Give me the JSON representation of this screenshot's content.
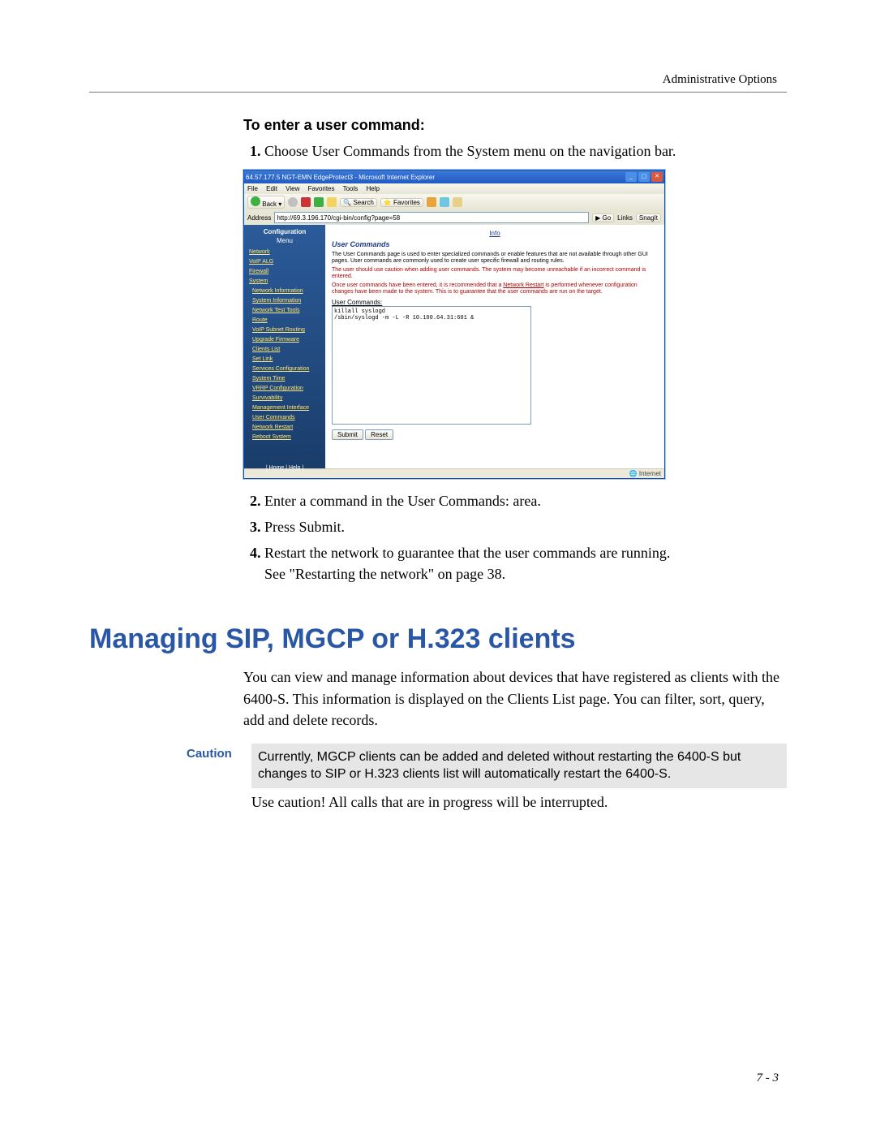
{
  "header": {
    "title": "Administrative Options"
  },
  "procedure": {
    "title": "To enter a user command:",
    "step1": "Choose User Commands from the System menu on the navigation bar.",
    "step2": "Enter a command in the User Commands: area.",
    "step3": "Press Submit.",
    "step4a": "Restart the network to guarantee that the user commands are running.",
    "step4b": "See \"Restarting the network\" on page 38."
  },
  "ie": {
    "title": "64.57.177.5 NGT-EMN EdgeProtect3 - Microsoft Internet Explorer",
    "menu": {
      "file": "File",
      "edit": "Edit",
      "view": "View",
      "fav": "Favorites",
      "tools": "Tools",
      "help": "Help"
    },
    "back": "Back",
    "search": "Search",
    "favbtn": "Favorites",
    "addr_label": "Address",
    "addr_value": "http://69.3.196.170/cgi-bin/config?page=58",
    "go": "Go",
    "links": "Links",
    "snag": "SnagIt",
    "status_left": "",
    "status_right": "Internet"
  },
  "sidebar": {
    "cfg_title": "Configuration",
    "cfg_sub": "Menu",
    "items": [
      "Network",
      "VoIP ALG",
      "Firewall",
      "System"
    ],
    "sys_items": [
      "Network Information",
      "System Information",
      "Network Test Tools",
      "Route",
      "VoIP Subnet Routing",
      "Upgrade Firmware",
      "Clients List",
      "Set Link",
      "Services Configuration",
      "System Time",
      "VRRP Configuration",
      "Survivability",
      "Management Interface",
      "User Commands",
      "Network Restart",
      "Reboot System"
    ],
    "foot": "| Home | Help |"
  },
  "main": {
    "info": "Info",
    "title": "User Commands",
    "desc": "The User Commands page is used to enter specialized commands or enable features that are not available through other GUI pages. User commands are commonly used to create user specific firewall and routing rules.",
    "warn1": "The user should use caution when adding user commands. The system may become unreachable if an incorrect command is entered.",
    "warn2a": "Once user commands have been entered, it is recommended that a ",
    "warn2_link": "Network Restart",
    "warn2b": " is performed whenever configuration changes have been made to the system. This is to guarantee that the user commands are run on the target.",
    "area_label": "User Commands:",
    "area_value": "killall syslogd\n/sbin/syslogd -m -L -R 10.100.64.31:601 &",
    "submit": "Submit",
    "reset": "Reset"
  },
  "h2": "Managing SIP, MGCP or H.323 clients",
  "para1": "You can view and manage information about devices that have registered as clients with the 6400-S. This information is displayed on the Clients List page. You can filter, sort, query, add and delete records.",
  "caution": {
    "label": "Caution",
    "boxed": "Currently, MGCP clients can be added and deleted without restarting the 6400-S but changes to SIP or H.323 clients list will automatically restart the 6400-S.",
    "line2": "Use caution! All calls that are in progress will be interrupted."
  },
  "page_num": "7 - 3"
}
